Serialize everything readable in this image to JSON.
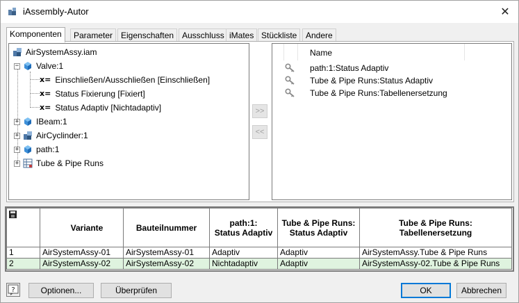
{
  "window": {
    "title": "iAssembly-Autor",
    "close_glyph": "✕"
  },
  "tabs": [
    "Komponenten",
    "Parameter",
    "Eigenschaften",
    "Ausschluss",
    "iMates",
    "Stückliste",
    "Andere"
  ],
  "tree": {
    "root": "AirSystemAssy.iam",
    "valve": "Valve:1",
    "valve_children": [
      "Einschließen/Ausschließen [Einschließen]",
      "Status Fixierung [Fixiert]",
      "Status Adaptiv [Nichtadaptiv]"
    ],
    "others": [
      "IBeam:1",
      "AirCyclinder:1",
      "path:1",
      "Tube & Pipe Runs"
    ],
    "param_marker": "x=",
    "expanded_glyph": "−",
    "collapsed_glyph": "+"
  },
  "move_buttons": {
    "add": ">>",
    "remove": "<<"
  },
  "right_list": {
    "header": "Name",
    "rows": [
      "path:1:Status Adaptiv",
      "Tube & Pipe Runs:Status Adaptiv",
      "Tube & Pipe Runs:Tabellenersetzung"
    ]
  },
  "table": {
    "headers": [
      "Variante",
      "Bauteilnummer",
      "path:1:\nStatus Adaptiv",
      "Tube & Pipe Runs:\nStatus Adaptiv",
      "Tube & Pipe Runs:\nTabellenersetzung"
    ],
    "rows": [
      {
        "num": "1",
        "cells": [
          "AirSystemAssy-01",
          "AirSystemAssy-01",
          "Adaptiv",
          "Adaptiv",
          "AirSystemAssy.Tube & Pipe Runs"
        ]
      },
      {
        "num": "2",
        "cells": [
          "AirSystemAssy-02",
          "AirSystemAssy-02",
          "Nichtadaptiv",
          "Adaptiv",
          "AirSystemAssy-02.Tube & Pipe Runs"
        ]
      }
    ]
  },
  "buttons": {
    "options": "Optionen...",
    "check": "Überprüfen",
    "ok": "OK",
    "cancel": "Abbrechen"
  },
  "colors": {
    "cube": "#3d8fd8",
    "selected_row": "#dff3df",
    "default_button_border": "#0078d7"
  }
}
